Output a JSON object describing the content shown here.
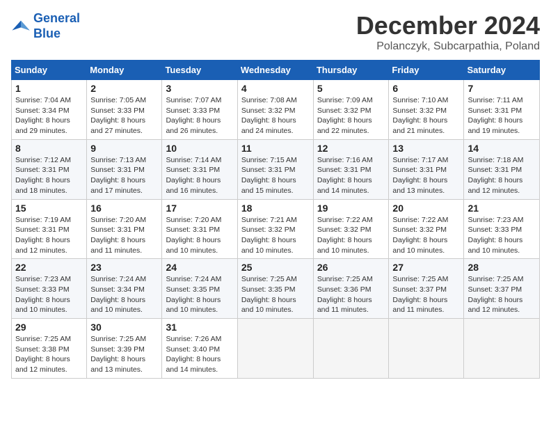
{
  "logo": {
    "line1": "General",
    "line2": "Blue"
  },
  "title": "December 2024",
  "location": "Polanczyk, Subcarpathia, Poland",
  "days_header": [
    "Sunday",
    "Monday",
    "Tuesday",
    "Wednesday",
    "Thursday",
    "Friday",
    "Saturday"
  ],
  "weeks": [
    [
      {
        "day": "1",
        "sunrise": "Sunrise: 7:04 AM",
        "sunset": "Sunset: 3:34 PM",
        "daylight": "Daylight: 8 hours and 29 minutes."
      },
      {
        "day": "2",
        "sunrise": "Sunrise: 7:05 AM",
        "sunset": "Sunset: 3:33 PM",
        "daylight": "Daylight: 8 hours and 27 minutes."
      },
      {
        "day": "3",
        "sunrise": "Sunrise: 7:07 AM",
        "sunset": "Sunset: 3:33 PM",
        "daylight": "Daylight: 8 hours and 26 minutes."
      },
      {
        "day": "4",
        "sunrise": "Sunrise: 7:08 AM",
        "sunset": "Sunset: 3:32 PM",
        "daylight": "Daylight: 8 hours and 24 minutes."
      },
      {
        "day": "5",
        "sunrise": "Sunrise: 7:09 AM",
        "sunset": "Sunset: 3:32 PM",
        "daylight": "Daylight: 8 hours and 22 minutes."
      },
      {
        "day": "6",
        "sunrise": "Sunrise: 7:10 AM",
        "sunset": "Sunset: 3:32 PM",
        "daylight": "Daylight: 8 hours and 21 minutes."
      },
      {
        "day": "7",
        "sunrise": "Sunrise: 7:11 AM",
        "sunset": "Sunset: 3:31 PM",
        "daylight": "Daylight: 8 hours and 19 minutes."
      }
    ],
    [
      {
        "day": "8",
        "sunrise": "Sunrise: 7:12 AM",
        "sunset": "Sunset: 3:31 PM",
        "daylight": "Daylight: 8 hours and 18 minutes."
      },
      {
        "day": "9",
        "sunrise": "Sunrise: 7:13 AM",
        "sunset": "Sunset: 3:31 PM",
        "daylight": "Daylight: 8 hours and 17 minutes."
      },
      {
        "day": "10",
        "sunrise": "Sunrise: 7:14 AM",
        "sunset": "Sunset: 3:31 PM",
        "daylight": "Daylight: 8 hours and 16 minutes."
      },
      {
        "day": "11",
        "sunrise": "Sunrise: 7:15 AM",
        "sunset": "Sunset: 3:31 PM",
        "daylight": "Daylight: 8 hours and 15 minutes."
      },
      {
        "day": "12",
        "sunrise": "Sunrise: 7:16 AM",
        "sunset": "Sunset: 3:31 PM",
        "daylight": "Daylight: 8 hours and 14 minutes."
      },
      {
        "day": "13",
        "sunrise": "Sunrise: 7:17 AM",
        "sunset": "Sunset: 3:31 PM",
        "daylight": "Daylight: 8 hours and 13 minutes."
      },
      {
        "day": "14",
        "sunrise": "Sunrise: 7:18 AM",
        "sunset": "Sunset: 3:31 PM",
        "daylight": "Daylight: 8 hours and 12 minutes."
      }
    ],
    [
      {
        "day": "15",
        "sunrise": "Sunrise: 7:19 AM",
        "sunset": "Sunset: 3:31 PM",
        "daylight": "Daylight: 8 hours and 12 minutes."
      },
      {
        "day": "16",
        "sunrise": "Sunrise: 7:20 AM",
        "sunset": "Sunset: 3:31 PM",
        "daylight": "Daylight: 8 hours and 11 minutes."
      },
      {
        "day": "17",
        "sunrise": "Sunrise: 7:20 AM",
        "sunset": "Sunset: 3:31 PM",
        "daylight": "Daylight: 8 hours and 10 minutes."
      },
      {
        "day": "18",
        "sunrise": "Sunrise: 7:21 AM",
        "sunset": "Sunset: 3:32 PM",
        "daylight": "Daylight: 8 hours and 10 minutes."
      },
      {
        "day": "19",
        "sunrise": "Sunrise: 7:22 AM",
        "sunset": "Sunset: 3:32 PM",
        "daylight": "Daylight: 8 hours and 10 minutes."
      },
      {
        "day": "20",
        "sunrise": "Sunrise: 7:22 AM",
        "sunset": "Sunset: 3:32 PM",
        "daylight": "Daylight: 8 hours and 10 minutes."
      },
      {
        "day": "21",
        "sunrise": "Sunrise: 7:23 AM",
        "sunset": "Sunset: 3:33 PM",
        "daylight": "Daylight: 8 hours and 10 minutes."
      }
    ],
    [
      {
        "day": "22",
        "sunrise": "Sunrise: 7:23 AM",
        "sunset": "Sunset: 3:33 PM",
        "daylight": "Daylight: 8 hours and 10 minutes."
      },
      {
        "day": "23",
        "sunrise": "Sunrise: 7:24 AM",
        "sunset": "Sunset: 3:34 PM",
        "daylight": "Daylight: 8 hours and 10 minutes."
      },
      {
        "day": "24",
        "sunrise": "Sunrise: 7:24 AM",
        "sunset": "Sunset: 3:35 PM",
        "daylight": "Daylight: 8 hours and 10 minutes."
      },
      {
        "day": "25",
        "sunrise": "Sunrise: 7:25 AM",
        "sunset": "Sunset: 3:35 PM",
        "daylight": "Daylight: 8 hours and 10 minutes."
      },
      {
        "day": "26",
        "sunrise": "Sunrise: 7:25 AM",
        "sunset": "Sunset: 3:36 PM",
        "daylight": "Daylight: 8 hours and 11 minutes."
      },
      {
        "day": "27",
        "sunrise": "Sunrise: 7:25 AM",
        "sunset": "Sunset: 3:37 PM",
        "daylight": "Daylight: 8 hours and 11 minutes."
      },
      {
        "day": "28",
        "sunrise": "Sunrise: 7:25 AM",
        "sunset": "Sunset: 3:37 PM",
        "daylight": "Daylight: 8 hours and 12 minutes."
      }
    ],
    [
      {
        "day": "29",
        "sunrise": "Sunrise: 7:25 AM",
        "sunset": "Sunset: 3:38 PM",
        "daylight": "Daylight: 8 hours and 12 minutes."
      },
      {
        "day": "30",
        "sunrise": "Sunrise: 7:25 AM",
        "sunset": "Sunset: 3:39 PM",
        "daylight": "Daylight: 8 hours and 13 minutes."
      },
      {
        "day": "31",
        "sunrise": "Sunrise: 7:26 AM",
        "sunset": "Sunset: 3:40 PM",
        "daylight": "Daylight: 8 hours and 14 minutes."
      },
      null,
      null,
      null,
      null
    ]
  ]
}
